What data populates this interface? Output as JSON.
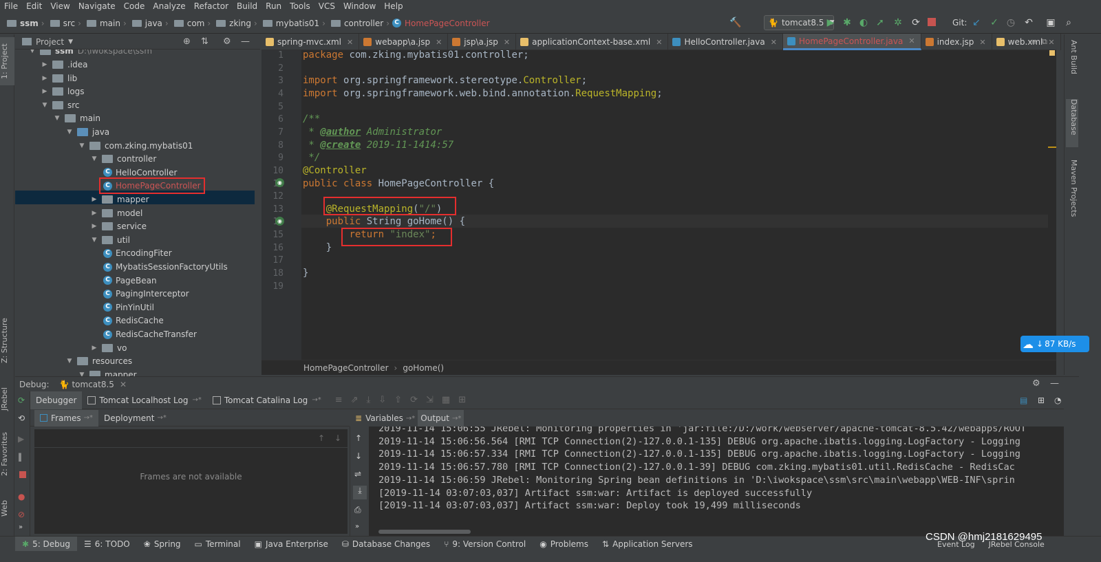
{
  "menu": [
    "File",
    "Edit",
    "View",
    "Navigate",
    "Code",
    "Analyze",
    "Refactor",
    "Build",
    "Run",
    "Tools",
    "VCS",
    "Window",
    "Help"
  ],
  "breadcrumb": [
    "ssm",
    "src",
    "main",
    "java",
    "com",
    "zking",
    "mybatis01",
    "controller",
    "HomePageController"
  ],
  "run_config": "tomcat8.5",
  "git_label": "Git:",
  "project_panel": {
    "title": "Project",
    "root_label": "ssm",
    "root_path": "D:\\iwokspace\\ssm",
    "tree": [
      {
        "label": ".idea",
        "depth": 1,
        "type": "folder",
        "expanded": false
      },
      {
        "label": "lib",
        "depth": 1,
        "type": "folder",
        "expanded": false
      },
      {
        "label": "logs",
        "depth": 1,
        "type": "folder",
        "expanded": false
      },
      {
        "label": "src",
        "depth": 1,
        "type": "folder",
        "expanded": true
      },
      {
        "label": "main",
        "depth": 2,
        "type": "folder",
        "expanded": true
      },
      {
        "label": "java",
        "depth": 3,
        "type": "src",
        "expanded": true
      },
      {
        "label": "com.zking.mybatis01",
        "depth": 4,
        "type": "pkg",
        "expanded": true
      },
      {
        "label": "controller",
        "depth": 5,
        "type": "pkg",
        "expanded": true
      },
      {
        "label": "HelloController",
        "depth": 6,
        "type": "class"
      },
      {
        "label": "HomePageController",
        "depth": 6,
        "type": "class",
        "selected": true
      },
      {
        "label": "mapper",
        "depth": 5,
        "type": "pkg",
        "expanded": false
      },
      {
        "label": "model",
        "depth": 5,
        "type": "pkg",
        "expanded": false
      },
      {
        "label": "service",
        "depth": 5,
        "type": "pkg",
        "expanded": false
      },
      {
        "label": "util",
        "depth": 5,
        "type": "pkg",
        "expanded": true
      },
      {
        "label": "EncodingFiter",
        "depth": 6,
        "type": "class"
      },
      {
        "label": "MybatisSessionFactoryUtils",
        "depth": 6,
        "type": "class"
      },
      {
        "label": "PageBean",
        "depth": 6,
        "type": "class"
      },
      {
        "label": "PagingInterceptor",
        "depth": 6,
        "type": "class"
      },
      {
        "label": "PinYinUtil",
        "depth": 6,
        "type": "class"
      },
      {
        "label": "RedisCache",
        "depth": 6,
        "type": "class"
      },
      {
        "label": "RedisCacheTransfer",
        "depth": 6,
        "type": "class"
      },
      {
        "label": "vo",
        "depth": 5,
        "type": "pkg",
        "expanded": false
      },
      {
        "label": "resources",
        "depth": 3,
        "type": "folder",
        "expanded": true
      },
      {
        "label": "mapper",
        "depth": 4,
        "type": "folder",
        "expanded": true
      }
    ]
  },
  "editor_tabs": [
    {
      "label": "spring-mvc.xml",
      "active": false,
      "color": "#e8bf6a"
    },
    {
      "label": "webapp\\a.jsp",
      "active": false,
      "color": "#cc7832"
    },
    {
      "label": "jsp\\a.jsp",
      "active": false,
      "color": "#cc7832"
    },
    {
      "label": "applicationContext-base.xml",
      "active": false,
      "color": "#e8bf6a"
    },
    {
      "label": "HelloController.java",
      "active": false,
      "color": "#3d8fbf"
    },
    {
      "label": "HomePageController.java",
      "active": true,
      "color": "#3d8fbf"
    },
    {
      "label": "index.jsp",
      "active": false,
      "color": "#cc7832"
    },
    {
      "label": "web.xml",
      "active": false,
      "color": "#e8bf6a"
    }
  ],
  "code_lines": [
    [
      {
        "c": "kw",
        "t": "package "
      },
      {
        "c": "",
        "t": "com.zking.mybatis01.controller;"
      }
    ],
    [],
    [
      {
        "c": "kw",
        "t": "import "
      },
      {
        "c": "",
        "t": "org.springframework.stereotype."
      },
      {
        "c": "ann",
        "t": "Controller"
      },
      {
        "c": "",
        "t": ";"
      }
    ],
    [
      {
        "c": "kw",
        "t": "import "
      },
      {
        "c": "",
        "t": "org.springframework.web.bind.annotation."
      },
      {
        "c": "ann",
        "t": "RequestMapping"
      },
      {
        "c": "",
        "t": ";"
      }
    ],
    [],
    [
      {
        "c": "cmt",
        "t": "/**"
      }
    ],
    [
      {
        "c": "cmt",
        "t": " * "
      },
      {
        "c": "tag",
        "t": "@author"
      },
      {
        "c": "cmt",
        "t": " Administrator"
      }
    ],
    [
      {
        "c": "cmt",
        "t": " * "
      },
      {
        "c": "tag",
        "t": "@create"
      },
      {
        "c": "cmt",
        "t": " 2019-11-1414:57"
      }
    ],
    [
      {
        "c": "cmt",
        "t": " */"
      }
    ],
    [
      {
        "c": "ann",
        "t": "@Controller"
      }
    ],
    [
      {
        "c": "kw",
        "t": "public class "
      },
      {
        "c": "",
        "t": "HomePageController {"
      }
    ],
    [],
    [
      {
        "c": "",
        "t": "    "
      },
      {
        "c": "ann",
        "t": "@RequestMapping"
      },
      {
        "c": "",
        "t": "("
      },
      {
        "c": "str",
        "t": "\"/\""
      },
      {
        "c": "",
        "t": ")"
      }
    ],
    [
      {
        "c": "",
        "t": "    "
      },
      {
        "c": "kw",
        "t": "public "
      },
      {
        "c": "",
        "t": "String goHome() {"
      }
    ],
    [
      {
        "c": "",
        "t": "        "
      },
      {
        "c": "kw",
        "t": "return "
      },
      {
        "c": "str",
        "t": "\"index\""
      },
      {
        "c": "kw",
        "t": ";"
      }
    ],
    [
      {
        "c": "",
        "t": "    }"
      }
    ],
    [],
    [
      {
        "c": "",
        "t": "}"
      }
    ],
    []
  ],
  "editor_breadcrumb": {
    "class": "HomePageController",
    "method": "goHome()"
  },
  "right_tools": [
    "Ant Build",
    "Database",
    "Maven Projects"
  ],
  "left_tools": {
    "project": "1: Project",
    "structure": "Z: Structure",
    "jrebel": "JRebel",
    "favorites": "2: Favorites",
    "web": "Web"
  },
  "debug": {
    "label": "Debug:",
    "config": "tomcat8.5",
    "tabs": [
      "Debugger",
      "Tomcat Localhost Log",
      "Tomcat Catalina Log"
    ],
    "frames_tabs": [
      "Frames",
      "Deployment"
    ],
    "frames_empty": "Frames are not available",
    "output_tabs": [
      "Variables",
      "Output"
    ],
    "output_lines": [
      "2019-11-14 15:06:55 JRebel: Monitoring properties in 'jar:file:/D:/work/webserver/apache-tomcat-8.5.42/webapps/ROOT",
      "2019-11-14 15:06:56.564 [RMI TCP Connection(2)-127.0.0.1-135] DEBUG org.apache.ibatis.logging.LogFactory - Logging",
      "2019-11-14 15:06:57.334 [RMI TCP Connection(2)-127.0.0.1-135] DEBUG org.apache.ibatis.logging.LogFactory - Logging",
      "2019-11-14 15:06:57.780 [RMI TCP Connection(2)-127.0.0.1-39] DEBUG com.zking.mybatis01.util.RedisCache - RedisCac",
      "2019-11-14 15:06:59 JRebel: Monitoring Spring bean definitions in 'D:\\iwokspace\\ssm\\src\\main\\webapp\\WEB-INF\\sprin",
      "[2019-11-14 03:07:03,037] Artifact ssm:war: Artifact is deployed successfully",
      "[2019-11-14 03:07:03,037] Artifact ssm:war: Deploy took 19,499 milliseconds"
    ]
  },
  "status_tabs": [
    "5: Debug",
    "6: TODO",
    "Spring",
    "Terminal",
    "Java Enterprise",
    "Database Changes",
    "9: Version Control",
    "Problems",
    "Application Servers"
  ],
  "status_right": [
    "Event Log",
    "JRebel Console"
  ],
  "net_speed": "87 KB/s",
  "watermark": "CSDN @hmj2181629495"
}
